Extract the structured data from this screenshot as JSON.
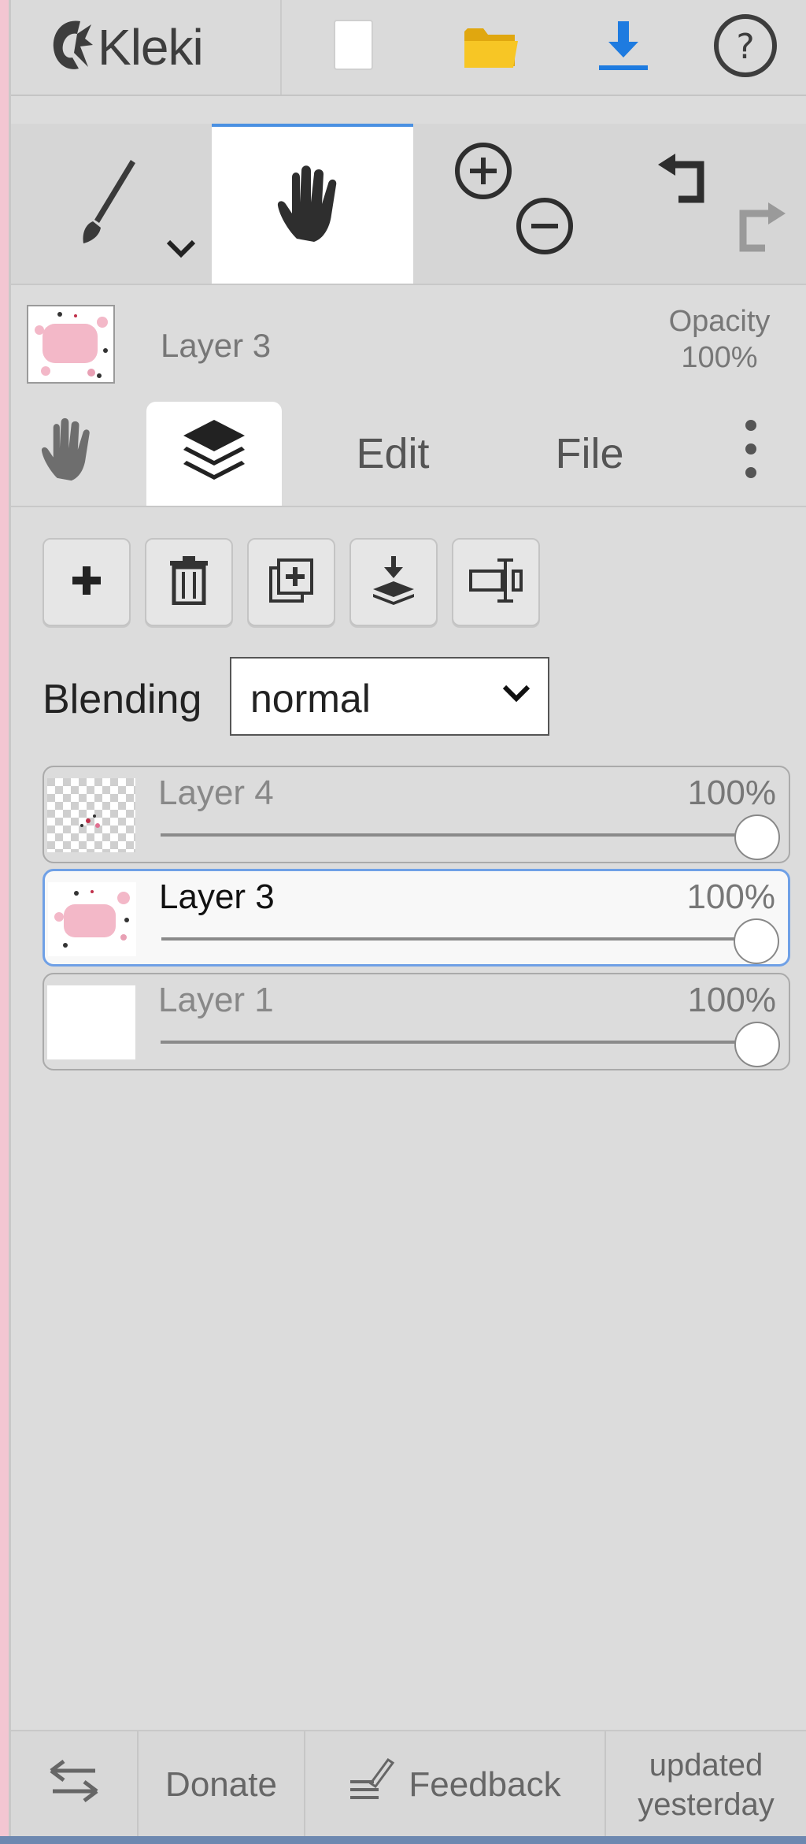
{
  "app": {
    "logo_text": "Kleki"
  },
  "topbar": {
    "icons": [
      "new-image-icon",
      "open-folder-icon",
      "download-icon",
      "help-icon"
    ],
    "colors": {
      "folder": "#f5c21b",
      "download": "#1e7be0"
    }
  },
  "tools": {
    "items": [
      "brush-tool",
      "hand-tool",
      "zoom-in",
      "zoom-out",
      "undo",
      "redo"
    ],
    "active": "hand-tool"
  },
  "current_layer": {
    "name": "Layer 3",
    "opacity_label": "Opacity",
    "opacity_value": "100%"
  },
  "tabs": {
    "edit": "Edit",
    "file": "File",
    "active": "layers"
  },
  "layer_actions": [
    "add-layer",
    "delete-layer",
    "duplicate-layer",
    "merge-down",
    "rename-layer"
  ],
  "blending": {
    "label": "Blending",
    "value": "normal"
  },
  "layers": [
    {
      "name": "Layer 4",
      "opacity": "100%",
      "opacity_fraction": 1.0,
      "selected": false
    },
    {
      "name": "Layer 3",
      "opacity": "100%",
      "opacity_fraction": 1.0,
      "selected": true
    },
    {
      "name": "Layer 1",
      "opacity": "100%",
      "opacity_fraction": 1.0,
      "selected": false
    }
  ],
  "footer": {
    "donate": "Donate",
    "feedback": "Feedback",
    "updated_line1": "updated",
    "updated_line2": "yesterday"
  },
  "accent_color": "#4a90e2"
}
